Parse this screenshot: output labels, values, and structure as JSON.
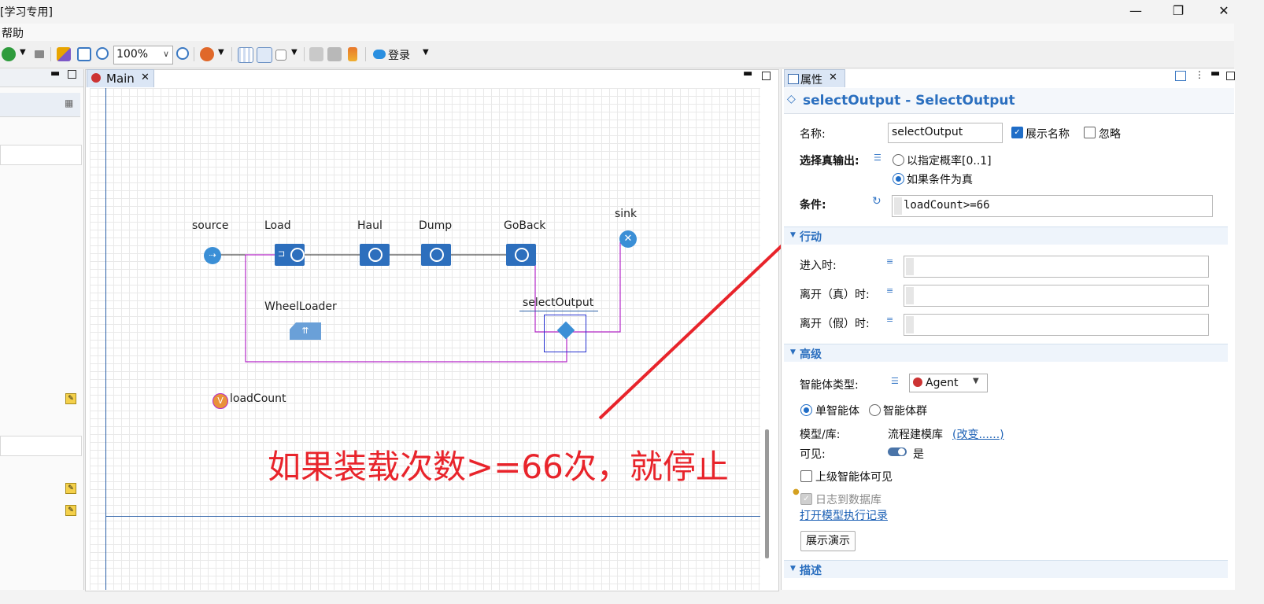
{
  "window": {
    "title": "[学习专用]",
    "min": "—",
    "max": "❐",
    "close": "✕"
  },
  "menu": {
    "help": "帮助"
  },
  "toolbar": {
    "zoom": "100%",
    "login": "登录"
  },
  "editor": {
    "tab_label": "Main",
    "blocks": {
      "source": "source",
      "load": "Load",
      "haul": "Haul",
      "dump": "Dump",
      "goback": "GoBack",
      "sink": "sink",
      "wheelloader": "WheelLoader",
      "selectoutput": "selectOutput",
      "loadcount": "loadCount",
      "loadcount_badge": "V"
    },
    "annotation": "如果装载次数>=66次，就停止"
  },
  "properties": {
    "tab_label": "属性",
    "heading": "selectOutput - SelectOutput",
    "name_label": "名称:",
    "name_value": "selectOutput",
    "show_name": "展示名称",
    "ignore": "忽略",
    "select_true_label": "选择真输出:",
    "opt_probability": "以指定概率[0..1]",
    "opt_condition": "如果条件为真",
    "condition_label": "条件:",
    "condition_value": "loadCount>=66",
    "actions_header": "行动",
    "on_enter": "进入时:",
    "on_exit_true": "离开（真）时:",
    "on_exit_false": "离开（假）时:",
    "advanced_header": "高级",
    "agent_type_label": "智能体类型:",
    "agent_type_value": "Agent",
    "single_agent": "单智能体",
    "agent_population": "智能体群",
    "model_label": "模型/库:",
    "model_value": "流程建模库",
    "change_link": "(改变......)",
    "visible_label": "可见:",
    "visible_value": "是",
    "parent_visible": "上级智能体可见",
    "log_db": "日志到数据库",
    "open_log": "打开模型执行记录",
    "show_demo": "展示演示",
    "desc_header": "描述"
  }
}
